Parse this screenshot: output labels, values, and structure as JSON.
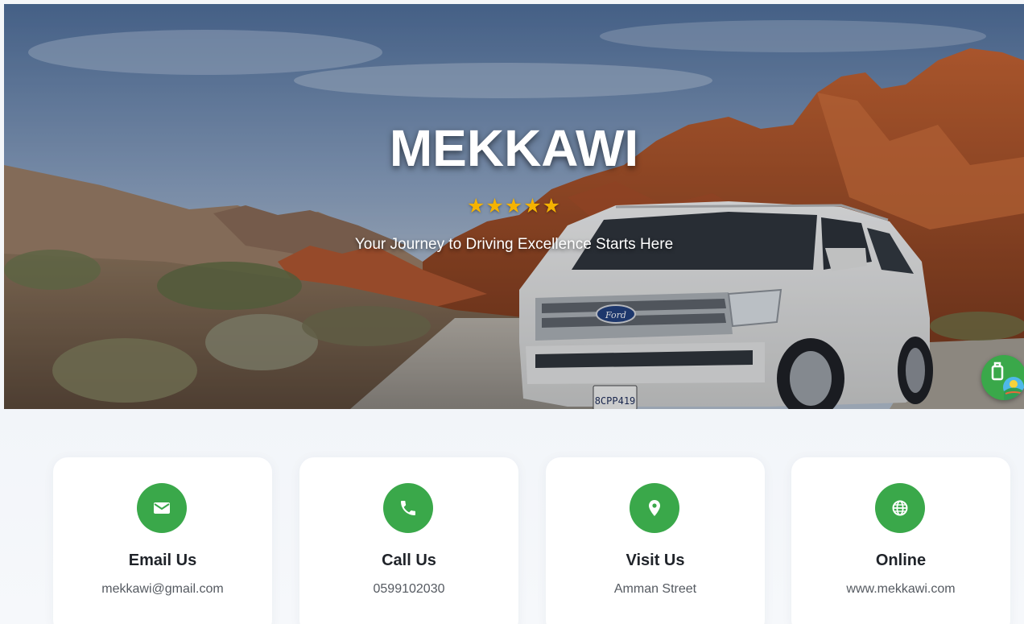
{
  "hero": {
    "brand": "MEKKAWI",
    "stars": "★★★★★",
    "rating_count": 5,
    "tagline": "Your Journey to Driving Excellence Starts Here",
    "license_plate": "8CPP419",
    "car_badge": "Ford"
  },
  "contact": [
    {
      "title": "Email Us",
      "value": "mekkawi@gmail.com",
      "icon": "mail-icon"
    },
    {
      "title": "Call Us",
      "value": "0599102030",
      "icon": "phone-icon"
    },
    {
      "title": "Visit Us",
      "value": "Amman Street",
      "icon": "location-pin-icon"
    },
    {
      "title": "Online",
      "value": "www.mekkawi.com",
      "icon": "globe-icon"
    }
  ],
  "colors": {
    "accent": "#3aa84a",
    "star": "#f5b301",
    "text_dark": "#1f2329",
    "text_muted": "#555a61"
  }
}
